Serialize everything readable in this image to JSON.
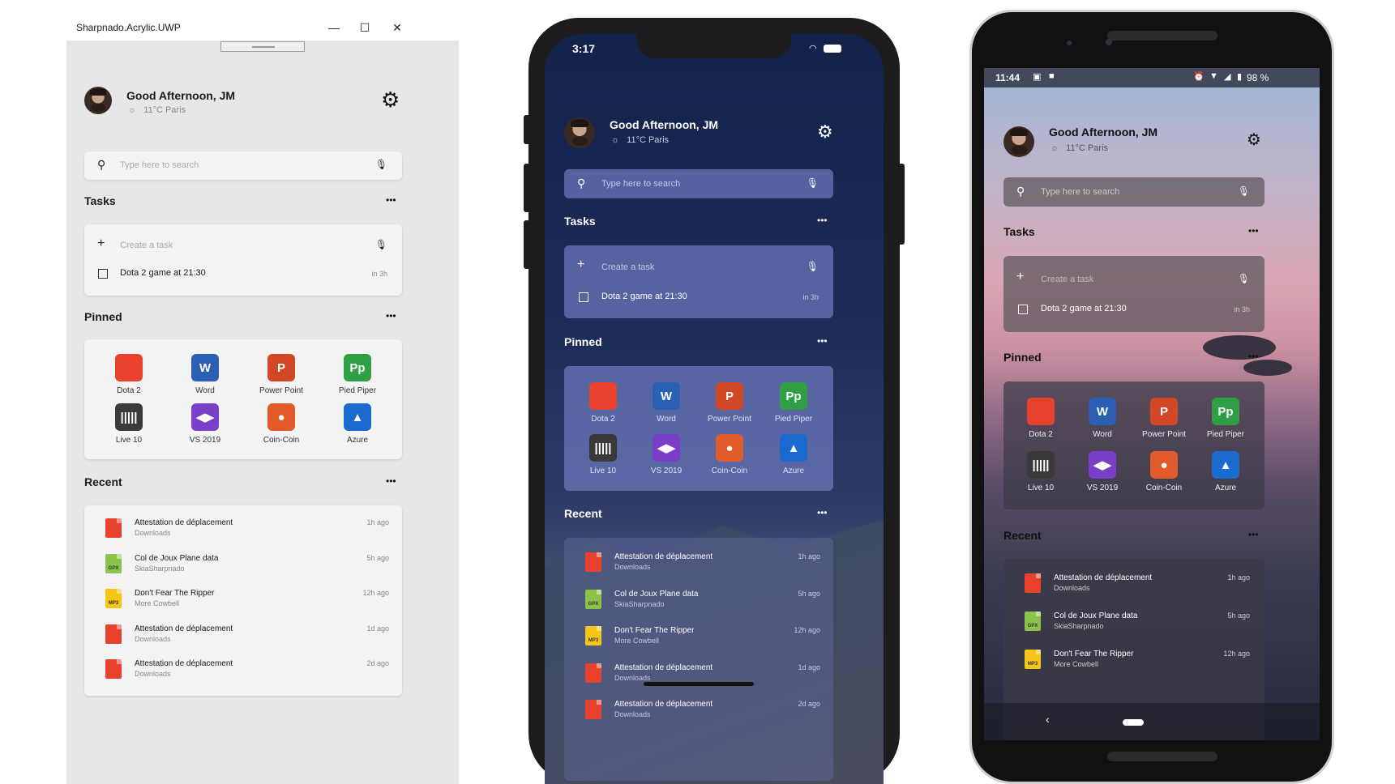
{
  "window": {
    "title": "Sharpnado.Acrylic.UWP",
    "minimize": "—",
    "maximize": "☐",
    "close": "✕"
  },
  "header": {
    "greeting": "Good Afternoon, JM",
    "weather": "11°C  Paris"
  },
  "search": {
    "placeholder": "Type here to search"
  },
  "tasks": {
    "title": "Tasks",
    "more": "•••",
    "create_placeholder": "Create a task",
    "items": [
      {
        "label": "Dota 2 game at 21:30",
        "due": "in 3h"
      }
    ]
  },
  "pinned": {
    "title": "Pinned",
    "more": "•••",
    "apps": [
      {
        "label": "Dota 2",
        "glyph": "",
        "color": "#e8412e",
        "icon": "dota2-icon"
      },
      {
        "label": "Word",
        "glyph": "W",
        "color": "#2b5fb4",
        "icon": "word-icon"
      },
      {
        "label": "Power Point",
        "glyph": "P",
        "color": "#d24726",
        "icon": "powerpoint-icon"
      },
      {
        "label": "Pied Piper",
        "glyph": "Pp",
        "color": "#2f9e44",
        "icon": "pied-piper-icon"
      },
      {
        "label": "Live 10",
        "glyph": "|||||",
        "color": "#3a3a3a",
        "icon": "live10-icon"
      },
      {
        "label": "VS 2019",
        "glyph": "◀▶",
        "color": "#7a3ec9",
        "icon": "visual-studio-icon"
      },
      {
        "label": "Coin-Coin",
        "glyph": "●",
        "color": "#e05a2a",
        "icon": "duckduckgo-icon"
      },
      {
        "label": "Azure",
        "glyph": "▲",
        "color": "#1b6ad0",
        "icon": "azure-icon"
      }
    ]
  },
  "recent": {
    "title": "Recent",
    "more": "•••",
    "items": [
      {
        "title": "Attestation de déplacement",
        "sub": "Downloads",
        "time": "1h ago",
        "type": "pdf",
        "color": "#e8412e",
        "tag": ""
      },
      {
        "title": "Col de Joux Plane data",
        "sub": "SkiaSharpnado",
        "time": "5h ago",
        "type": "gpx",
        "color": "#8bc34a",
        "tag": "GPX"
      },
      {
        "title": "Don't Fear The Ripper",
        "sub": "More Cowbell",
        "time": "12h ago",
        "type": "mp3",
        "color": "#f5c518",
        "tag": "MP3"
      },
      {
        "title": "Attestation de déplacement",
        "sub": "Downloads",
        "time": "1d ago",
        "type": "pdf",
        "color": "#e8412e",
        "tag": ""
      },
      {
        "title": "Attestation de déplacement",
        "sub": "Downloads",
        "time": "2d ago",
        "type": "pdf",
        "color": "#e8412e",
        "tag": ""
      }
    ]
  },
  "ios_status": {
    "time": "3:17"
  },
  "android_status": {
    "time": "11:44",
    "battery": "98 %"
  },
  "colors": {
    "uwp_background": "#e7e7e7",
    "ios_card": "#6c7abc",
    "android_card": "#5a545c"
  }
}
